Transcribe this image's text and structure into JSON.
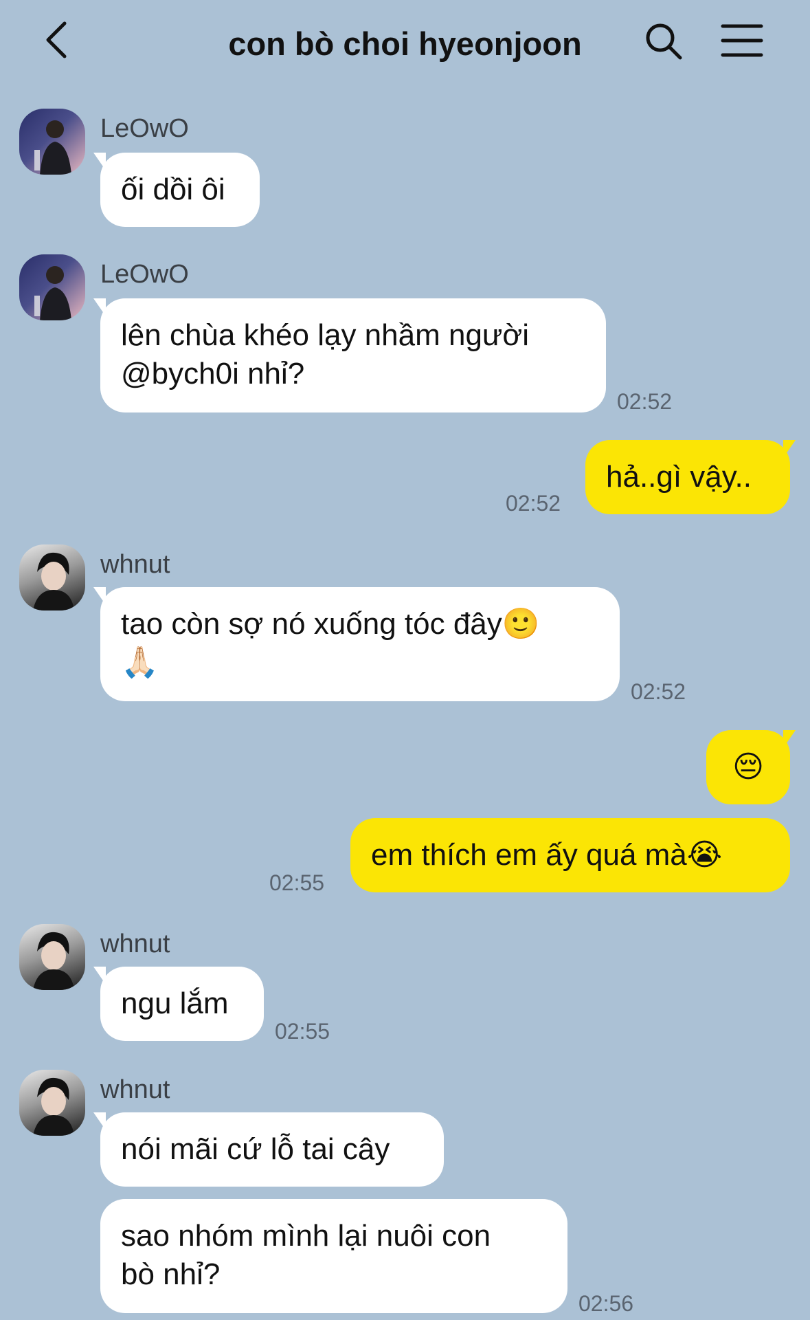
{
  "header": {
    "title": "con bò choi hyeonjoon",
    "back_icon": "chevron-left-icon",
    "search_icon": "search-icon",
    "menu_icon": "hamburger-menu-icon"
  },
  "colors": {
    "background": "#abc1d5",
    "incoming_bubble": "#ffffff",
    "outgoing_bubble": "#fbe505"
  },
  "messages": [
    {
      "sender": "LeOwO",
      "lines": [
        "ối dồi ôi"
      ],
      "time": ""
    },
    {
      "sender": "LeOwO",
      "lines": [
        "lên chùa khéo lạy nhầm người",
        "@bych0i nhỉ?"
      ],
      "time": "02:52"
    },
    {
      "sender": "me",
      "lines": [
        "hả..gì vậy.."
      ],
      "time": "02:52"
    },
    {
      "sender": "whnut",
      "lines": [
        "tao còn sợ nó xuống tóc đây🙂",
        "🙏🏻"
      ],
      "time": "02:52"
    },
    {
      "sender": "me",
      "lines": [
        "😔"
      ],
      "time": ""
    },
    {
      "sender": "me",
      "lines": [
        "em thích em ấy quá mà😭"
      ],
      "time": "02:55"
    },
    {
      "sender": "whnut",
      "lines": [
        "ngu lắm"
      ],
      "time": "02:55"
    },
    {
      "sender": "whnut",
      "lines": [
        "nói mãi cứ lỗ tai cây"
      ],
      "time": ""
    },
    {
      "sender": "whnut",
      "lines": [
        "sao nhóm mình lại nuôi con",
        "bò nhỉ?"
      ],
      "time": "02:56"
    }
  ]
}
